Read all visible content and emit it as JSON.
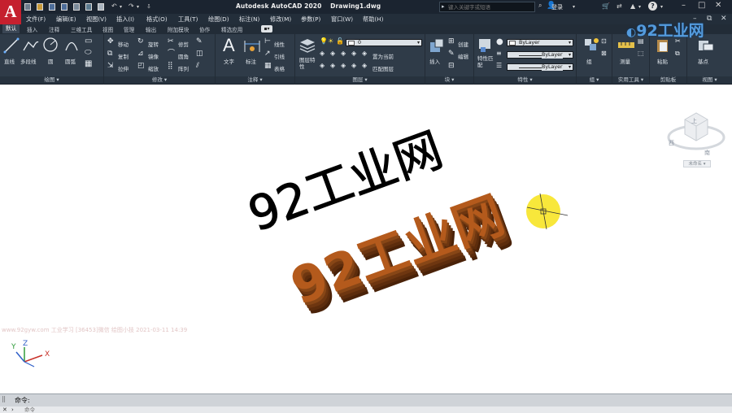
{
  "titlebar": {
    "app_logo": "A",
    "title": "Autodesk AutoCAD 2020",
    "document": "Drawing1.dwg",
    "search_placeholder": "键入关键字或短语",
    "login": "登录"
  },
  "menubar": {
    "items": [
      "文件(F)",
      "编辑(E)",
      "视图(V)",
      "插入(I)",
      "格式(O)",
      "工具(T)",
      "绘图(D)",
      "标注(N)",
      "修改(M)",
      "参数(P)",
      "窗口(W)",
      "帮助(H)"
    ]
  },
  "tabs": {
    "items": [
      "默认",
      "插入",
      "注释",
      "三维工具",
      "视图",
      "管理",
      "输出",
      "附加模块",
      "协作",
      "精选应用"
    ],
    "active": "默认"
  },
  "ribbon": {
    "draw": {
      "title": "绘图",
      "line": "直线",
      "polyline": "多段线",
      "circle": "圆",
      "arc": "圆弧"
    },
    "modify": {
      "title": "修改",
      "move": "移动",
      "rotate": "旋转",
      "trim": "修剪",
      "copy": "复制",
      "mirror": "镜像",
      "fillet": "圆角",
      "stretch": "拉伸",
      "scale": "缩放",
      "array": "阵列"
    },
    "annotation": {
      "title": "注释",
      "text": "文字",
      "dimension": "标注",
      "linear": "线性",
      "leader": "引线",
      "table": "表格"
    },
    "layers": {
      "title": "图层",
      "layer_properties": "图层特性",
      "current_layer": "0",
      "set_current": "置为当前",
      "match_layer": "匹配图层"
    },
    "block": {
      "title": "块",
      "insert": "插入",
      "create": "创建",
      "edit": "编辑"
    },
    "properties": {
      "title": "特性",
      "match_properties": "特性匹配",
      "color": "ByLayer",
      "linetype": "ByLayer",
      "lineweight": "ByLayer"
    },
    "groups": {
      "title": "组",
      "group": "组"
    },
    "utilities": {
      "title": "实用工具",
      "measure": "测量"
    },
    "clipboard": {
      "title": "剪贴板",
      "paste": "粘贴"
    },
    "view": {
      "title": "视图",
      "base": "基点"
    }
  },
  "drawing": {
    "flat_text": "92工业网",
    "extruded_text": "92工业网",
    "watermark": "www.92gyw.com 工业学习 [36453]微信 绘图小技 2021-03-11 14:39",
    "viewcube": {
      "top": "上",
      "west": "西",
      "south": "南",
      "label": "未命名"
    },
    "ucs": {
      "y": "Y",
      "z": "Z",
      "x": "X"
    }
  },
  "overlay_logo": "92工业网",
  "command": {
    "history": "命令:",
    "prompt": "命令"
  },
  "colors": {
    "title_bg": "#1b2430",
    "ribbon_bg": "#2f3b48",
    "extrude_front": "#b45a1c",
    "extrude_side": "#6e3610",
    "highlight": "#f7e52a"
  }
}
